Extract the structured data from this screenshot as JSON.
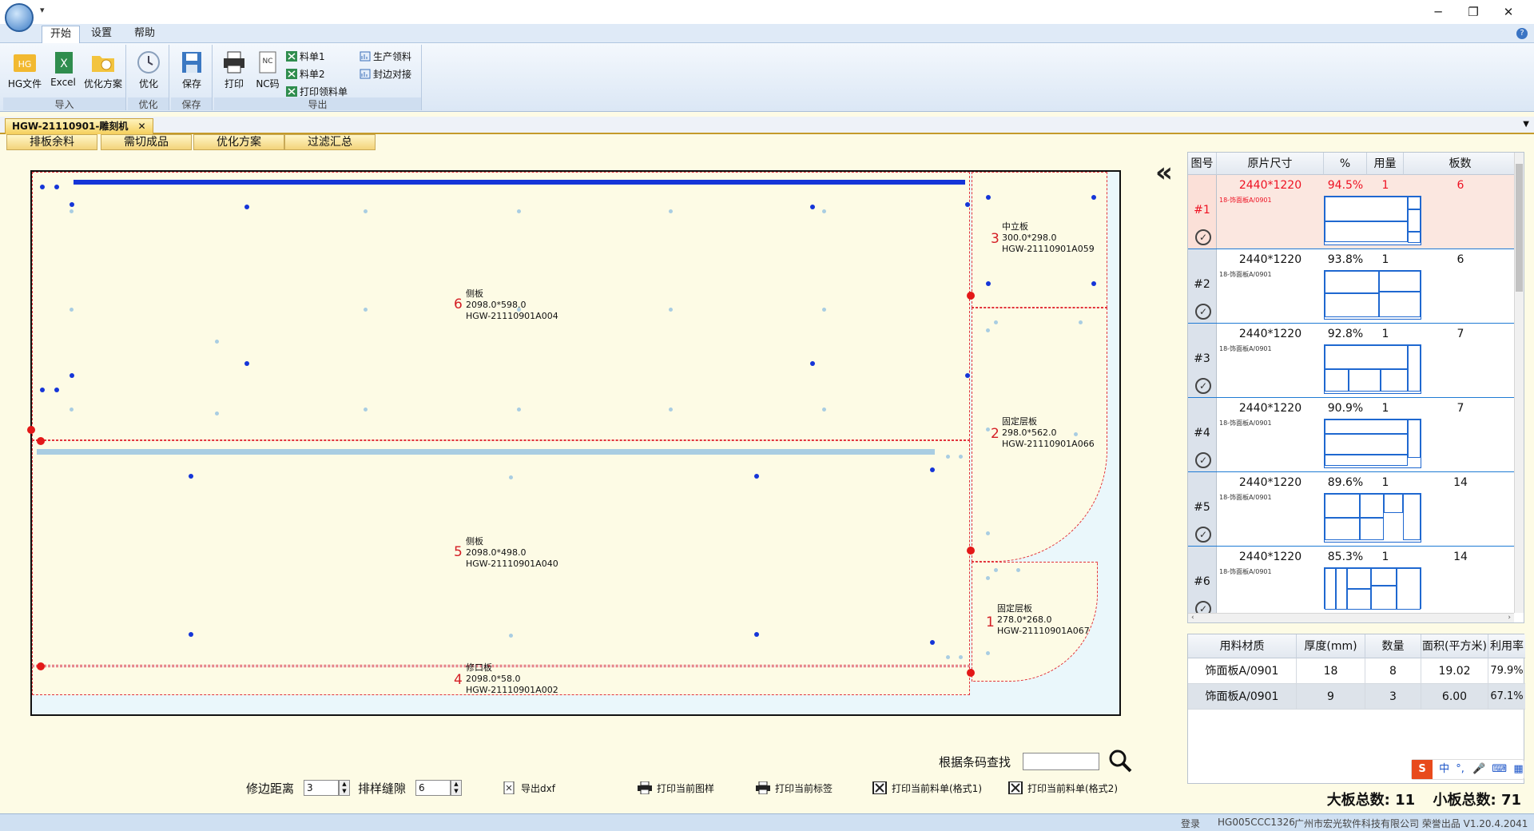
{
  "menu": {
    "tabs": [
      "开始",
      "设置",
      "帮助"
    ]
  },
  "ribbon": {
    "import_group": {
      "caption": "导入",
      "hg_file": "HG文件",
      "excel": "Excel",
      "plan": "优化方案"
    },
    "optimize_group": {
      "caption": "优化",
      "optimize": "优化"
    },
    "save_group": {
      "caption": "保存",
      "save": "保存"
    },
    "export_group": {
      "caption": "导出",
      "print": "打印",
      "nc": "NC码",
      "list1": "料单1",
      "list2": "料单2",
      "print_picklist": "打印领料单",
      "prod_picklist": "生产领料",
      "edge_match": "封边对接"
    }
  },
  "document_tab": {
    "label": "HGW-21110901-雕刻机"
  },
  "sub_tabs": [
    "排板余料",
    "需切成品",
    "优化方案",
    "过滤汇总"
  ],
  "parts": [
    {
      "num": "6",
      "name": "侧板",
      "size": "2098.0*598.0",
      "code": "HGW-21110901A004"
    },
    {
      "num": "5",
      "name": "侧板",
      "size": "2098.0*498.0",
      "code": "HGW-21110901A040"
    },
    {
      "num": "4",
      "name": "修口板",
      "size": "2098.0*58.0",
      "code": "HGW-21110901A002"
    },
    {
      "num": "3",
      "name": "中立板",
      "size": "300.0*298.0",
      "code": "HGW-21110901A059"
    },
    {
      "num": "2",
      "name": "固定层板",
      "size": "298.0*562.0",
      "code": "HGW-21110901A066"
    },
    {
      "num": "1",
      "name": "固定层板",
      "size": "278.0*268.0",
      "code": "HGW-21110901A067"
    }
  ],
  "sheet_table": {
    "headers": [
      "图号",
      "原片尺寸",
      "%",
      "用量",
      "板数"
    ],
    "rows": [
      {
        "id": "#1",
        "size": "2440*1220",
        "pct": "94.5%",
        "qty": "1",
        "count": "6",
        "material": "18-饰面板A/0901"
      },
      {
        "id": "#2",
        "size": "2440*1220",
        "pct": "93.8%",
        "qty": "1",
        "count": "6",
        "material": "18-饰面板A/0901"
      },
      {
        "id": "#3",
        "size": "2440*1220",
        "pct": "92.8%",
        "qty": "1",
        "count": "7",
        "material": "18-饰面板A/0901"
      },
      {
        "id": "#4",
        "size": "2440*1220",
        "pct": "90.9%",
        "qty": "1",
        "count": "7",
        "material": "18-饰面板A/0901"
      },
      {
        "id": "#5",
        "size": "2440*1220",
        "pct": "89.6%",
        "qty": "1",
        "count": "14",
        "material": "18-饰面板A/0901"
      },
      {
        "id": "#6",
        "size": "2440*1220",
        "pct": "85.3%",
        "qty": "1",
        "count": "14",
        "material": "18-饰面板A/0901"
      }
    ]
  },
  "summary_table": {
    "headers": [
      "用料材质",
      "厚度(mm)",
      "数量",
      "面积(平方米)",
      "利用率"
    ],
    "rows": [
      {
        "material": "饰面板A/0901",
        "thickness": "18",
        "qty": "8",
        "area": "19.02",
        "rate": "79.9%"
      },
      {
        "material": "饰面板A/0901",
        "thickness": "9",
        "qty": "3",
        "area": "6.00",
        "rate": "67.1%"
      }
    ]
  },
  "totals": {
    "big": "大板总数:  11",
    "small": "小板总数:  71"
  },
  "search": {
    "label": "根据条码查找",
    "value": ""
  },
  "controls": {
    "trim_label": "修边距离",
    "trim_value": "3",
    "gap_label": "排样缝隙",
    "gap_value": "6",
    "export_dxf": "导出dxf",
    "print_drawing": "打印当前图样",
    "print_label": "打印当前标签",
    "print_list1": "打印当前料单(格式1)",
    "print_list2": "打印当前料单(格式2)"
  },
  "ime": {
    "lang": "中"
  },
  "status": {
    "login": "登录",
    "machine": "HG005CCC1326",
    "company": "广州市宏光软件科技有限公司 荣誉出品 V1.20.4.2041"
  },
  "colors": {
    "accent_red": "#e31818",
    "hole_blue": "#1535d8",
    "selection_blue": "#1f7bd4",
    "panel_bg": "#fdfbe5"
  }
}
